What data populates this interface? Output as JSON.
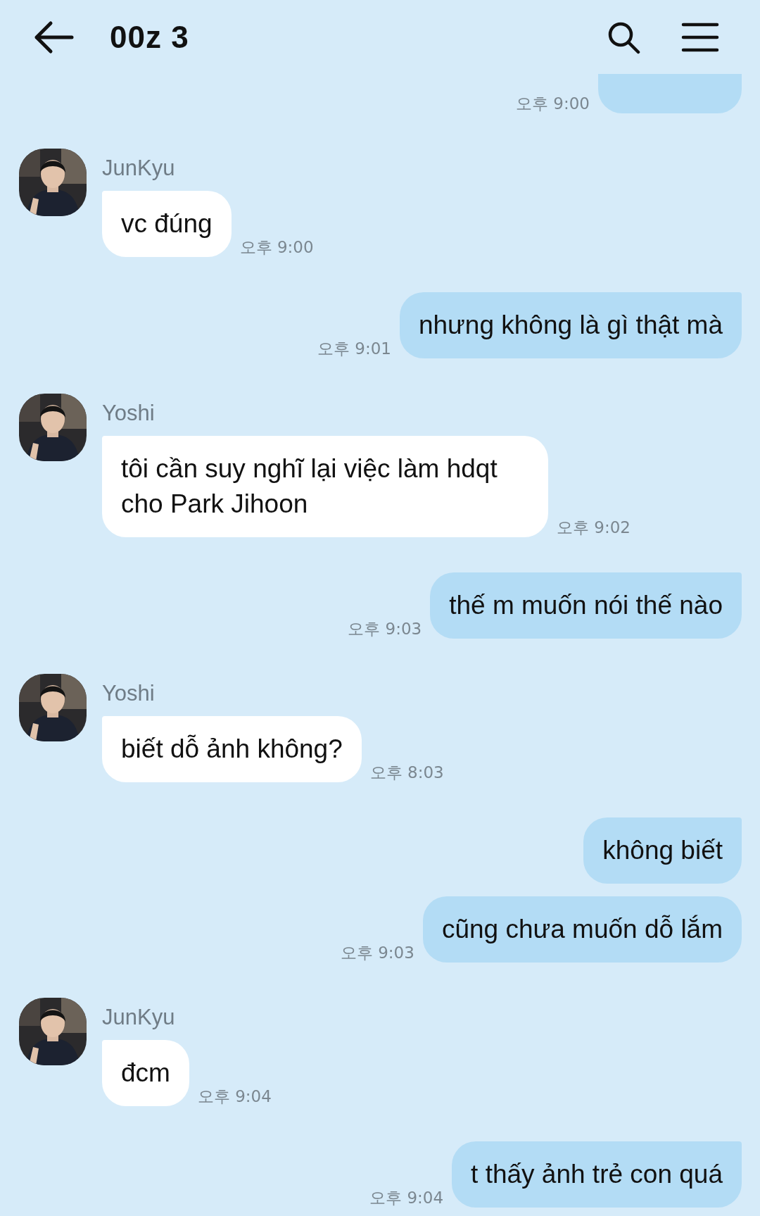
{
  "header": {
    "title": "00z 3"
  },
  "messages": [
    {
      "kind": "outgoing",
      "time": "오후 9:00"
    },
    {
      "kind": "incoming",
      "sender": "JunKyu",
      "text": "vc đúng",
      "time": "오후 9:00"
    },
    {
      "kind": "outgoing",
      "text": "nhưng không là gì thật mà",
      "time": "오후 9:01"
    },
    {
      "kind": "incoming",
      "sender": "Yoshi",
      "text": "tôi cần suy nghĩ lại việc làm hdqt cho Park Jihoon",
      "time": "오후 9:02"
    },
    {
      "kind": "outgoing",
      "text": "thế m muốn nói thế nào",
      "time": "오후 9:03"
    },
    {
      "kind": "incoming",
      "sender": "Yoshi",
      "text": "biết dỗ ảnh không?",
      "time": "오후 8:03"
    },
    {
      "kind": "outgoing",
      "text": "không biết"
    },
    {
      "kind": "outgoing",
      "text": "cũng chưa muốn dỗ lắm",
      "time": "오후 9:03"
    },
    {
      "kind": "incoming",
      "sender": "JunKyu",
      "text": "đcm",
      "time": "오후 9:04"
    },
    {
      "kind": "outgoing",
      "text": "t thấy ảnh trẻ con quá",
      "time": "오후 9:04"
    }
  ]
}
